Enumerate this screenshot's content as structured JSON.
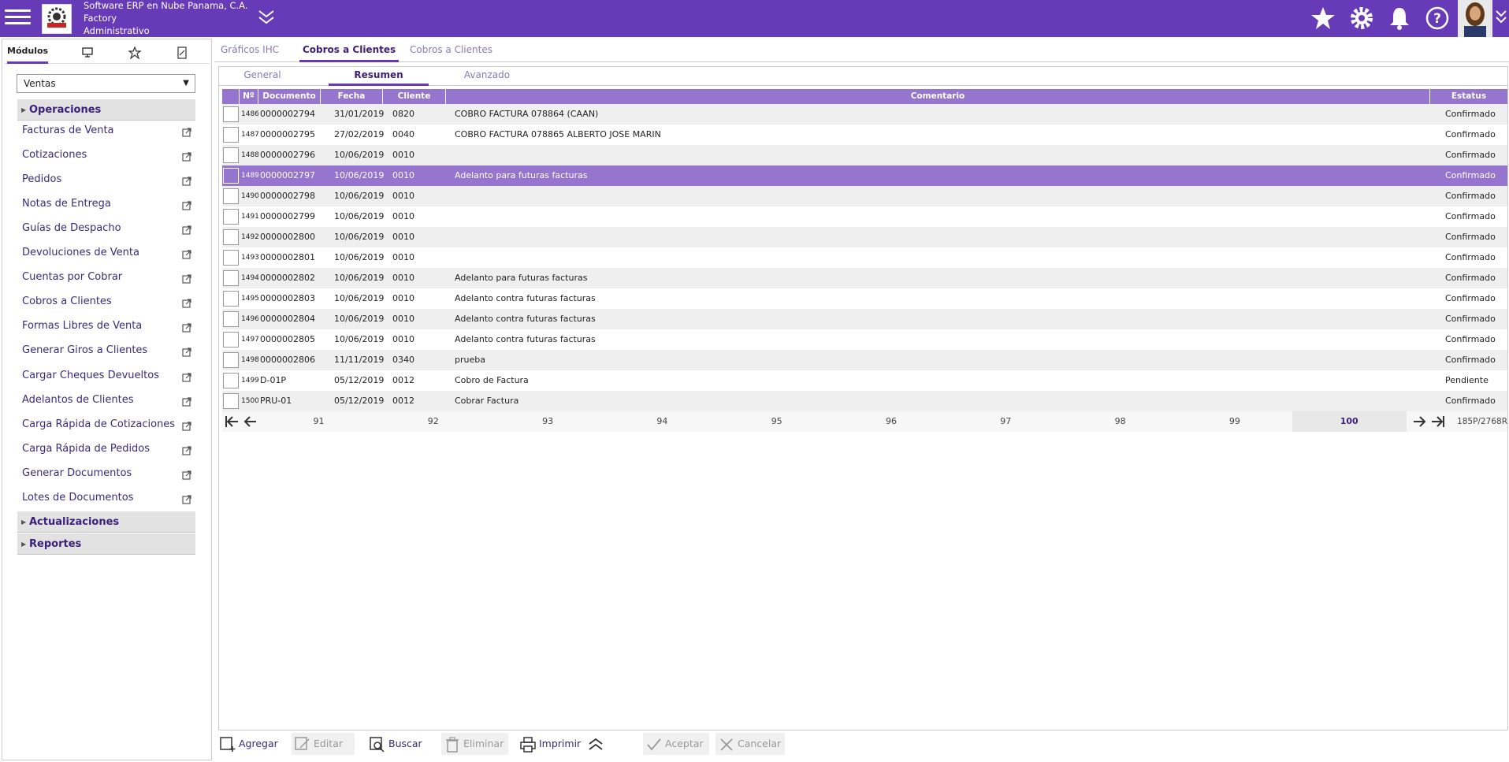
{
  "topbar": {
    "company_line1": "Software ERP en Nube Panama, C.A.",
    "company_line2": "Factory",
    "company_line3": "Administrativo",
    "icons": [
      "menu-icon",
      "chevron-down-icon",
      "star-icon",
      "gear-icon",
      "bell-icon",
      "help-icon",
      "avatar"
    ],
    "bg_color": "#673ab7"
  },
  "left": {
    "tab_modules": "Módulos",
    "selected_module": "Ventas",
    "sections": {
      "operaciones": "Operaciones",
      "actualizaciones": "Actualizaciones",
      "reportes": "Reportes"
    },
    "items": [
      "Facturas de Venta",
      "Cotizaciones",
      "Pedidos",
      "Notas de Entrega",
      "Guías de Despacho",
      "Devoluciones de Venta",
      "Cuentas por Cobrar",
      "Cobros a Clientes",
      "Formas Libres de Venta",
      "Generar Giros a Clientes",
      "Cargar Cheques Devueltos",
      "Adelantos de Clientes",
      "Carga Rápida de Cotizaciones",
      "Carga Rápida de Pedidos",
      "Generar Documentos",
      "Lotes de Documentos"
    ]
  },
  "main_tabs": [
    "Gráficos IHC",
    "Cobros a Clientes",
    "Cobros a Clientes"
  ],
  "sub_tabs": [
    "General",
    "Resumen",
    "Avanzado"
  ],
  "grid": {
    "headers": {
      "num": "Nº",
      "doc": "Documento",
      "fecha": "Fecha",
      "cliente": "Cliente",
      "comentario": "Comentario",
      "estatus": "Estatus"
    },
    "rows": [
      {
        "num": "1486",
        "doc": "0000002794",
        "fecha": "31/01/2019",
        "cliente": "0820",
        "comentario": "COBRO FACTURA 078864 (CAAN)",
        "estatus": "Confirmado"
      },
      {
        "num": "1487",
        "doc": "0000002795",
        "fecha": "27/02/2019",
        "cliente": "0040",
        "comentario": "COBRO FACTURA 078865 ALBERTO JOSE MARIN",
        "estatus": "Confirmado"
      },
      {
        "num": "1488",
        "doc": "0000002796",
        "fecha": "10/06/2019",
        "cliente": "0010",
        "comentario": "",
        "estatus": "Confirmado"
      },
      {
        "num": "1489",
        "doc": "0000002797",
        "fecha": "10/06/2019",
        "cliente": "0010",
        "comentario": "Adelanto para futuras facturas",
        "estatus": "Confirmado"
      },
      {
        "num": "1490",
        "doc": "0000002798",
        "fecha": "10/06/2019",
        "cliente": "0010",
        "comentario": "",
        "estatus": "Confirmado"
      },
      {
        "num": "1491",
        "doc": "0000002799",
        "fecha": "10/06/2019",
        "cliente": "0010",
        "comentario": "",
        "estatus": "Confirmado"
      },
      {
        "num": "1492",
        "doc": "0000002800",
        "fecha": "10/06/2019",
        "cliente": "0010",
        "comentario": "",
        "estatus": "Confirmado"
      },
      {
        "num": "1493",
        "doc": "0000002801",
        "fecha": "10/06/2019",
        "cliente": "0010",
        "comentario": "",
        "estatus": "Confirmado"
      },
      {
        "num": "1494",
        "doc": "0000002802",
        "fecha": "10/06/2019",
        "cliente": "0010",
        "comentario": "Adelanto para futuras facturas",
        "estatus": "Confirmado"
      },
      {
        "num": "1495",
        "doc": "0000002803",
        "fecha": "10/06/2019",
        "cliente": "0010",
        "comentario": "Adelanto contra futuras facturas",
        "estatus": "Confirmado"
      },
      {
        "num": "1496",
        "doc": "0000002804",
        "fecha": "10/06/2019",
        "cliente": "0010",
        "comentario": "Adelanto contra futuras facturas",
        "estatus": "Confirmado"
      },
      {
        "num": "1497",
        "doc": "0000002805",
        "fecha": "10/06/2019",
        "cliente": "0010",
        "comentario": "Adelanto contra futuras facturas",
        "estatus": "Confirmado"
      },
      {
        "num": "1498",
        "doc": "0000002806",
        "fecha": "11/11/2019",
        "cliente": "0340",
        "comentario": "prueba",
        "estatus": "Confirmado"
      },
      {
        "num": "1499",
        "doc": "D-01P",
        "fecha": "05/12/2019",
        "cliente": "0012",
        "comentario": "Cobro de Factura",
        "estatus": "Pendiente"
      },
      {
        "num": "1500",
        "doc": "PRU-01",
        "fecha": "05/12/2019",
        "cliente": "0012",
        "comentario": "Cobrar Factura",
        "estatus": "Confirmado"
      }
    ],
    "selected_row": 3
  },
  "pager": {
    "pages": [
      "91",
      "92",
      "93",
      "94",
      "95",
      "96",
      "97",
      "98",
      "99",
      "100"
    ],
    "current": "100",
    "summary": "185P/2768R"
  },
  "toolbar": {
    "agregar": "Agregar",
    "editar": "Editar",
    "buscar": "Buscar",
    "eliminar": "Eliminar",
    "imprimir": "Imprimir",
    "aceptar": "Aceptar",
    "cancelar": "Cancelar"
  }
}
